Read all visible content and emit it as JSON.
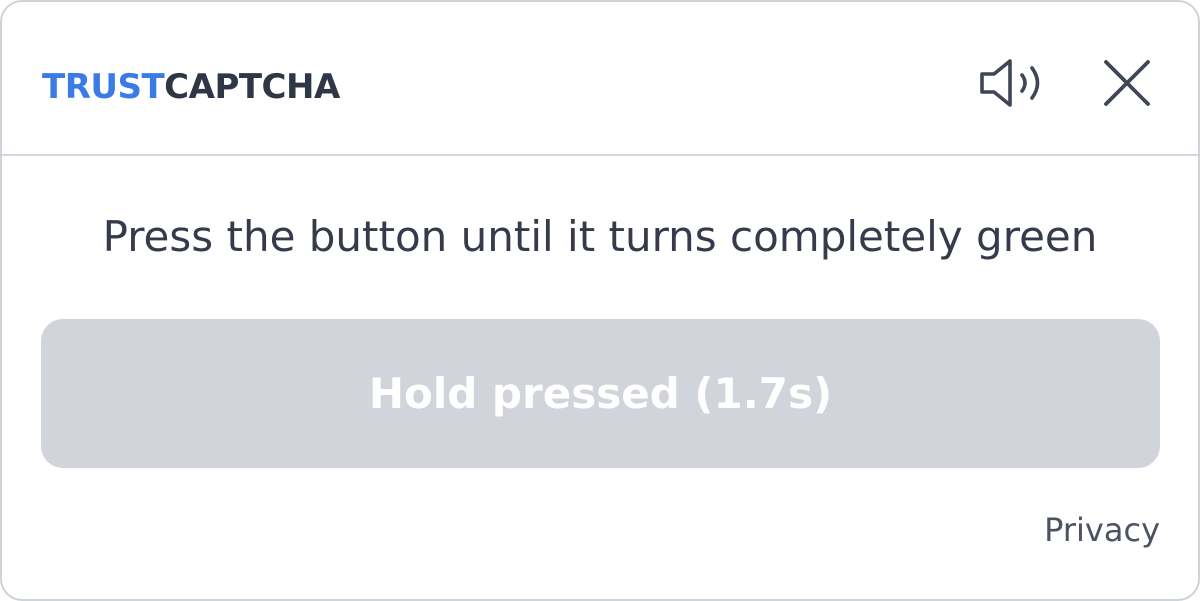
{
  "header": {
    "logo": {
      "part1": "TRUST",
      "part2": "CAPTCHA",
      "part1_color": "#3b7be6",
      "part2_color": "#2f3747"
    },
    "sound_icon": "speaker-icon",
    "close_icon": "close-icon"
  },
  "main": {
    "instruction": "Press the button until it turns completely green",
    "hold_button": {
      "label": "Hold pressed (1.7s)",
      "background_color": "#d2d4db",
      "progress_color": "#22c55e",
      "progress": 0
    }
  },
  "footer": {
    "privacy_link": "Privacy"
  },
  "colors": {
    "border": "#cfd2d8",
    "text": "#353b4a"
  }
}
